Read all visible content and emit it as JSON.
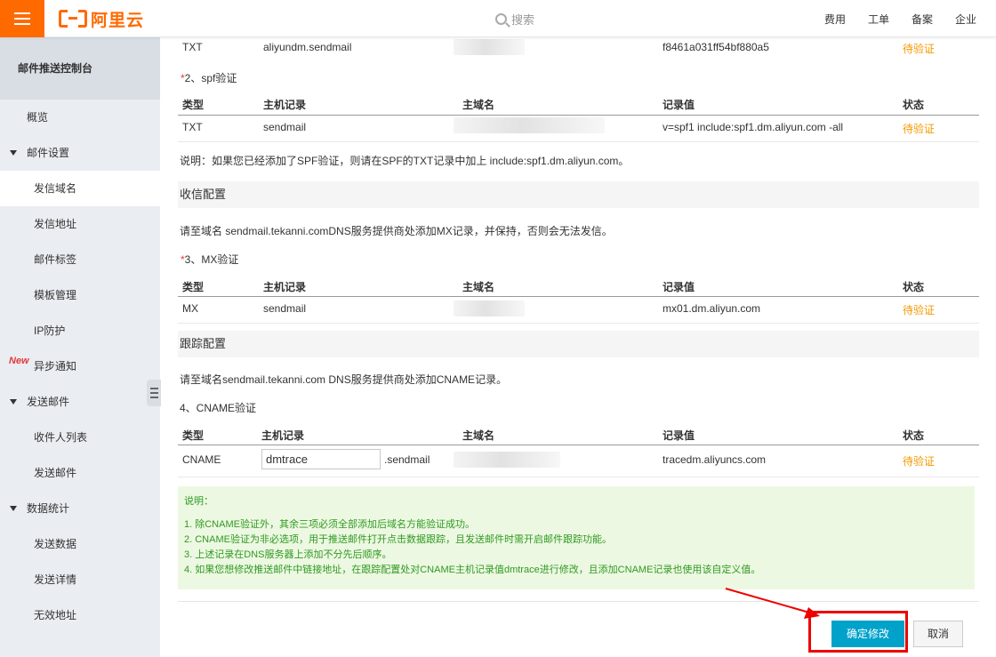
{
  "brand": {
    "name": "阿里云",
    "color": "#ff6a00"
  },
  "search": {
    "placeholder": "搜索",
    "icon": "search-icon"
  },
  "top_nav": [
    "费用",
    "工单",
    "备案",
    "企业"
  ],
  "sidebar": {
    "title": "邮件推送控制台",
    "overview": "概览",
    "groups": [
      {
        "label": "邮件设置",
        "items": [
          "发信域名",
          "发信地址",
          "邮件标签",
          "模板管理",
          "IP防护",
          "异步通知"
        ]
      },
      {
        "label": "发送邮件",
        "items": [
          "收件人列表",
          "发送邮件"
        ]
      },
      {
        "label": "数据统计",
        "items": [
          "发送数据",
          "发送详情",
          "无效地址"
        ]
      }
    ],
    "new_badge": "New",
    "active_item": "发信域名"
  },
  "content": {
    "top_row": {
      "type": "TXT",
      "host": "aliyundm.sendmail",
      "value": "f8461a031ff54bf880a5",
      "status": "待验证"
    },
    "spf": {
      "title": "2、spf验证",
      "headers": [
        "类型",
        "主机记录",
        "主域名",
        "记录值",
        "状态"
      ],
      "row": {
        "type": "TXT",
        "host": "sendmail",
        "value": "v=spf1 include:spf1.dm.aliyun.com -all",
        "status": "待验证"
      },
      "note": "说明：如果您已经添加了SPF验证，则请在SPF的TXT记录中加上 include:spf1.dm.aliyun.com。"
    },
    "receive": {
      "section": "收信配置",
      "desc": "请至域名 sendmail.tekanni.comDNS服务提供商处添加MX记录，并保持，否则会无法发信。",
      "title": "3、MX验证",
      "headers": [
        "类型",
        "主机记录",
        "主域名",
        "记录值",
        "状态"
      ],
      "row": {
        "type": "MX",
        "host": "sendmail",
        "value": "mx01.dm.aliyun.com",
        "status": "待验证"
      }
    },
    "tracking": {
      "section": "跟踪配置",
      "desc": "请至域名sendmail.tekanni.com DNS服务提供商处添加CNAME记录。",
      "title": "4、CNAME验证",
      "headers": [
        "类型",
        "主机记录",
        "主域名",
        "记录值",
        "状态"
      ],
      "row": {
        "type": "CNAME",
        "host_input": "dmtrace",
        "host_suffix": ".sendmail",
        "value": "tracedm.aliyuncs.com",
        "status": "待验证"
      }
    },
    "notes": {
      "title": "说明：",
      "lines": [
        "1. 除CNAME验证外，其余三项必须全部添加后域名方能验证成功。",
        "2. CNAME验证为非必选项，用于推送邮件打开点击数据跟踪，且发送邮件时需开启邮件跟踪功能。",
        "3. 上述记录在DNS服务器上添加不分先后顺序。",
        "4. 如果您想修改推送邮件中链接地址，在跟踪配置处对CNAME主机记录值dmtrace进行修改，且添加CNAME记录也使用该自定义值。"
      ]
    }
  },
  "buttons": {
    "confirm": "确定修改",
    "cancel": "取消"
  },
  "colors": {
    "pending": "#f39800",
    "primary": "#00a2ca",
    "note_bg": "#edf8e2",
    "note_text": "#2f9a22",
    "highlight": "#e00000"
  }
}
